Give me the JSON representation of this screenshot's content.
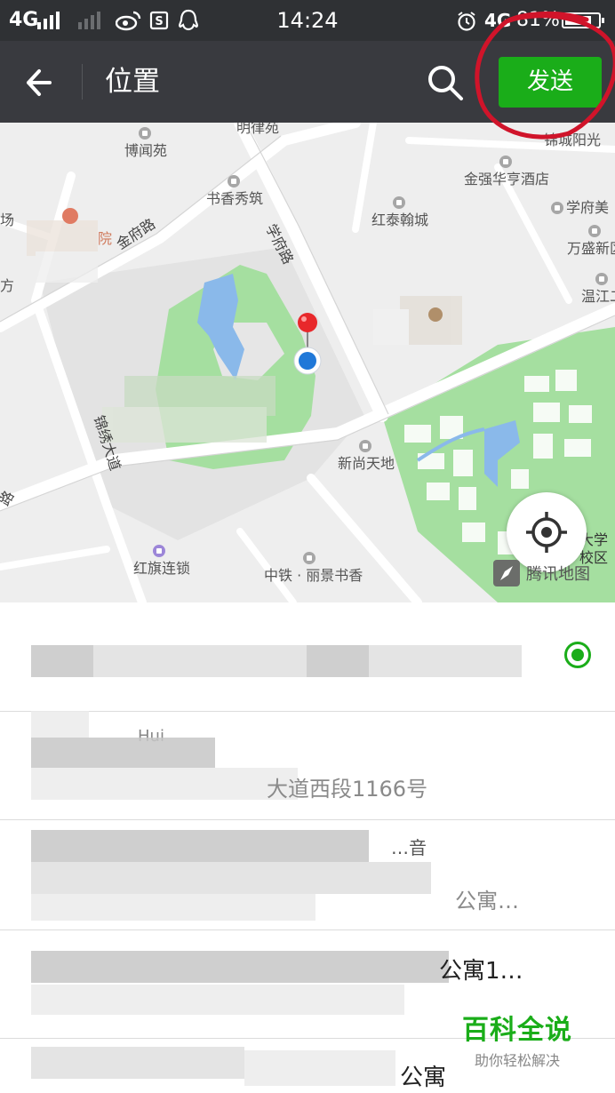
{
  "status_bar": {
    "network_left": "4G",
    "time": "14:24",
    "network_right": "4G",
    "battery_percent": "81%",
    "battery_level": 0.81
  },
  "nav": {
    "title": "位置",
    "send_label": "发送"
  },
  "map": {
    "labels": {
      "mingluyuan": "明律苑",
      "bowenyuan": "博闻苑",
      "shuxiangxiuzhu": "书香秀筑",
      "jinqiang": "金强华亨酒店",
      "xuefumei": "学府美",
      "hongtai": "红泰翰城",
      "wansheng": "万盛新区",
      "wenjiang": "温江二",
      "xinshang": "新尚天地",
      "hongqi": "红旗连锁",
      "zhongtie": "中铁 · 丽景书香",
      "gongyuan_partial": "场",
      "hospital_partial": "院",
      "left_partial": "方",
      "jinchengyangguang": "锦城阳光",
      "daxue": "大学",
      "xiaoqu": "校区"
    },
    "roads": {
      "jinfu": "金府路",
      "xuefu": "学府路",
      "dadao": "锦绣大道",
      "lu_partial": "路"
    },
    "brand": "腾讯地图"
  },
  "list": {
    "items": [
      {
        "title": "",
        "address": ""
      },
      {
        "title": "Hui",
        "address": "大道西段1166号"
      },
      {
        "title": "…音",
        "address": "公寓…"
      },
      {
        "title": "公寓1…",
        "address": ""
      },
      {
        "title": "公寓",
        "address": ""
      }
    ]
  },
  "watermark": {
    "title": "百科全说",
    "subtitle": "助你轻松解决"
  },
  "colors": {
    "accent_green": "#1aad19",
    "nav_bg": "#393a3f",
    "status_bg": "#2f3134",
    "annotation_red": "#d0142a"
  }
}
